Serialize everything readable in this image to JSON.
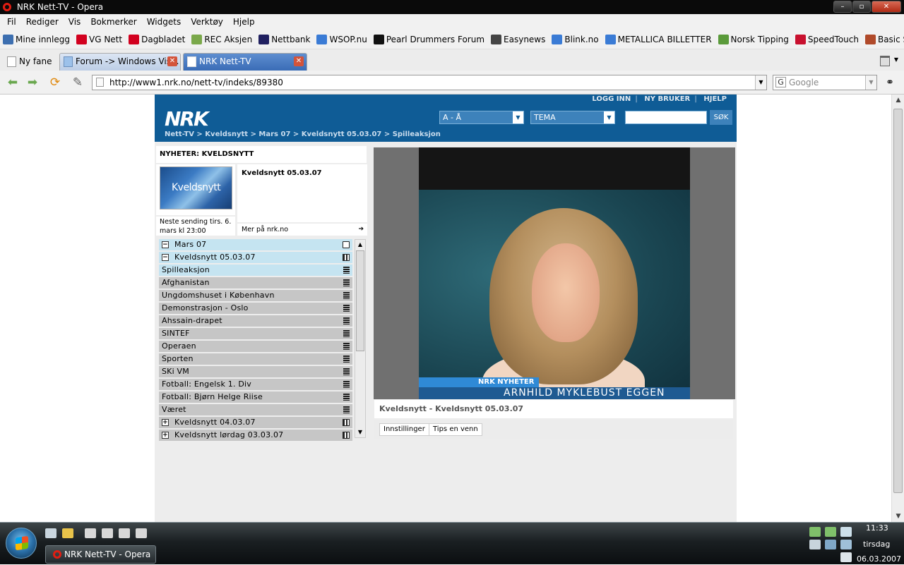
{
  "window": {
    "title": "NRK Nett-TV - Opera"
  },
  "menu": [
    "Fil",
    "Rediger",
    "Vis",
    "Bokmerker",
    "Widgets",
    "Verktøy",
    "Hjelp"
  ],
  "bookmarks": [
    {
      "label": "Mine innlegg",
      "icon": "hw-logo-icon",
      "color": "#3d6fb0"
    },
    {
      "label": "VG Nett",
      "icon": "vg-logo-icon",
      "color": "#d2001e"
    },
    {
      "label": "Dagbladet",
      "icon": "dagbladet-logo-icon",
      "color": "#d2001e"
    },
    {
      "label": "REC Aksjen",
      "icon": "page-icon",
      "color": "#7aa84a"
    },
    {
      "label": "Nettbank",
      "icon": "bank-icon",
      "color": "#202060"
    },
    {
      "label": "WSOP.nu",
      "icon": "globe-icon",
      "color": "#3a7bd5"
    },
    {
      "label": "Pearl Drummers Forum",
      "icon": "pearl-icon",
      "color": "#111111"
    },
    {
      "label": "Easynews",
      "icon": "smiley-icon",
      "color": "#444444"
    },
    {
      "label": "Blink.no",
      "icon": "blink-icon",
      "color": "#3a7bd5"
    },
    {
      "label": "METALLICA BILLETTER",
      "icon": "metallica-icon",
      "color": "#3a7bd5"
    },
    {
      "label": "Norsk Tipping",
      "icon": "page-icon",
      "color": "#5a9a3a"
    },
    {
      "label": "SpeedTouch",
      "icon": "speedtouch-icon",
      "color": "#c8102e"
    },
    {
      "label": "Basic Setup",
      "icon": "page-icon",
      "color": "#b04a2a"
    }
  ],
  "tabs": [
    {
      "label": "Ny fane"
    },
    {
      "label": "Forum -> Windows Vis..."
    },
    {
      "label": "NRK Nett-TV"
    }
  ],
  "address": {
    "url": "http://www1.nrk.no/nett-tv/indeks/89380",
    "search_placeholder": "Google"
  },
  "nrk": {
    "logo": "NRK",
    "top_links": [
      "LOGG INN",
      "NY BRUKER",
      "HJELP"
    ],
    "select_az": "A - Å",
    "select_tema": "TEMA",
    "search_button": "SØK",
    "breadcrumb": "Nett-TV > Kveldsnytt > Mars 07 > Kveldsnytt 05.03.07 > Spilleaksjon",
    "section_title": "NYHETER: KVELDSNYTT",
    "thumb_text": "Kveldsnytt",
    "next_broadcast": "Neste sending tirs. 6. mars kl 23:00",
    "episode_title": "Kveldsnytt 05.03.07",
    "more_link": "Mer på nrk.no",
    "tree": [
      {
        "label": "Mars 07",
        "level": 0,
        "toggle": "−",
        "icon": "folder",
        "highlight": true
      },
      {
        "label": "Kveldsnytt 05.03.07",
        "level": 0,
        "toggle": "−",
        "icon": "film",
        "highlight": true
      },
      {
        "label": "Spilleaksjon",
        "level": 1,
        "icon": "clip",
        "highlight": true
      },
      {
        "label": "Afghanistan",
        "level": 1,
        "icon": "clip"
      },
      {
        "label": "Ungdomshuset i København",
        "level": 1,
        "icon": "clip"
      },
      {
        "label": "Demonstrasjon - Oslo",
        "level": 1,
        "icon": "clip"
      },
      {
        "label": "Ahssain-drapet",
        "level": 1,
        "icon": "clip"
      },
      {
        "label": "SINTEF",
        "level": 1,
        "icon": "clip"
      },
      {
        "label": "Operaen",
        "level": 1,
        "icon": "clip"
      },
      {
        "label": "Sporten",
        "level": 1,
        "icon": "clip"
      },
      {
        "label": "SKi VM",
        "level": 1,
        "icon": "clip"
      },
      {
        "label": "Fotball: Engelsk 1. Div",
        "level": 1,
        "icon": "clip"
      },
      {
        "label": "Fotball: Bjørn Helge Riise",
        "level": 1,
        "icon": "clip"
      },
      {
        "label": "Været",
        "level": 1,
        "icon": "clip"
      },
      {
        "label": "Kveldsnytt 04.03.07",
        "level": 0,
        "toggle": "+",
        "icon": "film"
      },
      {
        "label": "Kveldsnytt lørdag 03.03.07",
        "level": 0,
        "toggle": "+",
        "icon": "film"
      }
    ],
    "video": {
      "channel_tag": "NRK NYHETER",
      "lower_third_name": "ARNHILD MYKLEBUST EGGEN"
    },
    "caption": "Kveldsnytt - Kveldsnytt 05.03.07",
    "player_buttons": [
      "Innstillinger",
      "Tips en venn"
    ]
  },
  "taskbar": {
    "task_label": "NRK Nett-TV - Opera",
    "clock_time": "11:33",
    "clock_day": "tirsdag",
    "clock_date": "06.03.2007"
  },
  "colors": {
    "nrk_blue": "#0f5c96",
    "tree_highlight": "#c5e4f1",
    "tree_row": "#c6c6c6",
    "active_tab": "#3a6cb6"
  }
}
